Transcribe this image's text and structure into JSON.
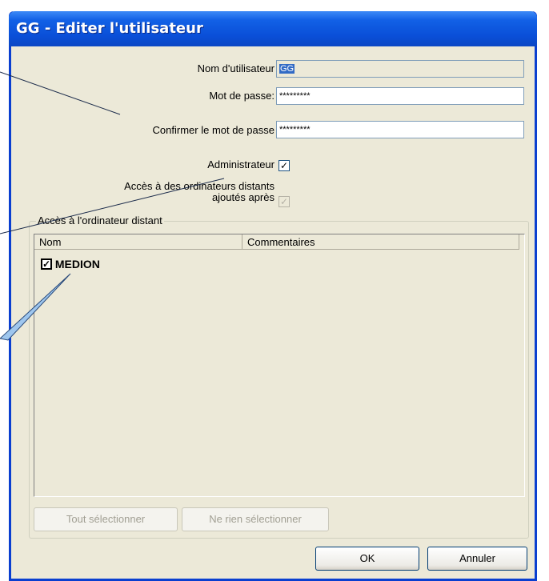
{
  "window": {
    "title": "GG - Editer l'utilisateur"
  },
  "form": {
    "username_label": "Nom d'utilisateur",
    "username_value": "GG",
    "password_label": "Mot de passe:",
    "password_value": "*********",
    "confirm_label": "Confirmer le mot de passe",
    "confirm_value": "*********",
    "admin_label": "Administrateur",
    "admin_checked": "✓",
    "remote_label_line1": "Accès à des ordinateurs distants",
    "remote_label_line2": "ajoutés après",
    "remote_checked": "✓"
  },
  "group": {
    "legend": "Accès à l'ordinateur distant",
    "columns": [
      "Nom",
      "Commentaires"
    ],
    "rows": [
      {
        "name": "MEDION",
        "checked": "✓"
      }
    ],
    "select_all_label": "Tout sélectionner",
    "select_none_label": "Ne rien sélectionner"
  },
  "buttons": {
    "ok_label": "OK",
    "cancel_label": "Annuler"
  },
  "colors": {
    "titlebar": "#0a4fd8",
    "dialog_bg": "#ece9d8",
    "selection": "#316ac5"
  }
}
